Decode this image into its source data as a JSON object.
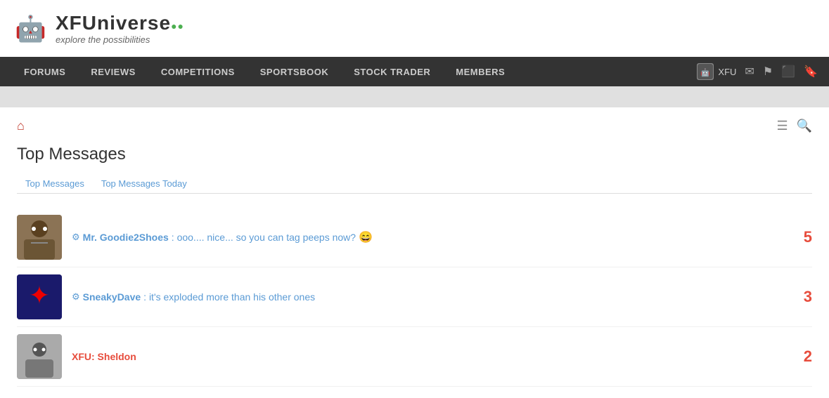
{
  "logo": {
    "title": "XFUniverse",
    "dots": "●●",
    "subtitle": "explore the possibilities"
  },
  "nav": {
    "items": [
      {
        "label": "FORUMS",
        "id": "forums"
      },
      {
        "label": "REVIEWS",
        "id": "reviews"
      },
      {
        "label": "COMPETITIONS",
        "id": "competitions"
      },
      {
        "label": "SPORTSBOOK",
        "id": "sportsbook"
      },
      {
        "label": "STOCK TRADER",
        "id": "stock-trader"
      },
      {
        "label": "MEMBERS",
        "id": "members"
      }
    ],
    "user_label": "XFU",
    "icons": [
      "envelope",
      "flag",
      "coins",
      "bookmark"
    ]
  },
  "page": {
    "title": "Top Messages"
  },
  "tabs": [
    {
      "label": "Top Messages",
      "active": true
    },
    {
      "label": "Top Messages Today",
      "active": false
    }
  ],
  "messages": [
    {
      "user": "Mr. Goodie2Shoes",
      "text": ": ooo.... nice... so you can tag peeps now?",
      "has_emoji": true,
      "emoji": "😄",
      "votes": "5",
      "avatar_letter": "🤖"
    },
    {
      "user": "SneakyDave",
      "text": ": it's exploded more than his other ones",
      "has_emoji": false,
      "votes": "3",
      "avatar_letter": "✦"
    },
    {
      "user": "XFU: Sheldon",
      "text": "",
      "is_red": true,
      "has_emoji": false,
      "votes": "2",
      "avatar_letter": "🤖"
    }
  ]
}
